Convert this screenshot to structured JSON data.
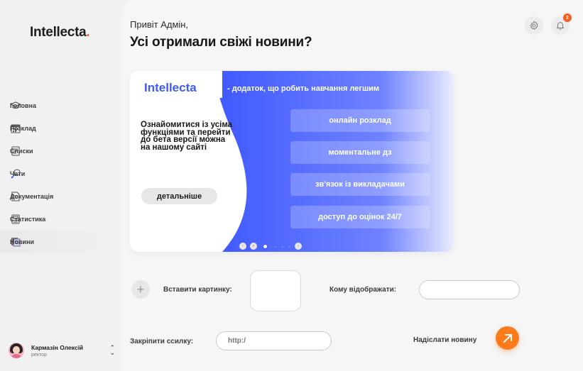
{
  "sidebar": {
    "logo_text": "Intellecta",
    "logo_dot": ".",
    "items": [
      {
        "label": "Головна",
        "icon": "graduation-cap-icon"
      },
      {
        "label": "Розклад",
        "icon": "calendar-icon"
      },
      {
        "label": "Списки",
        "icon": "list-icon"
      },
      {
        "label": "Чати",
        "icon": "chat-icon"
      },
      {
        "label": "Документація",
        "icon": "document-icon"
      },
      {
        "label": "Статистика",
        "icon": "statistics-icon"
      },
      {
        "label": "Новини",
        "icon": "news-icon"
      }
    ],
    "active_item": "Новини",
    "user": {
      "name": "Кармазін Олексій",
      "role": "ректор"
    }
  },
  "header": {
    "greeting": "Привіт Адмін,",
    "title": "Усі отримали свіжі новини?",
    "notification_count": "2"
  },
  "banner": {
    "brand": "Intellecta",
    "tagline": "- додаток, що робить навчання легшим",
    "left_text": "Ознайомитися із усіма функціями та перейти до бета версії можна на нашому сайті",
    "button": "детальніше",
    "features": [
      "онлайн розклад",
      "моментальне дз",
      "зв'язок із викладачами",
      "доступ до оцінок 24/7"
    ],
    "accent": "#3f58ff"
  },
  "form": {
    "insert_image_label": "Вставити картинку:",
    "audience_label": "Кому відображати:",
    "audience_value": "",
    "link_label": "Закріпити ссилку:",
    "link_placeholder": "http:/",
    "send_label": "Надіслати новину",
    "send_color": "#ff7a1a"
  }
}
